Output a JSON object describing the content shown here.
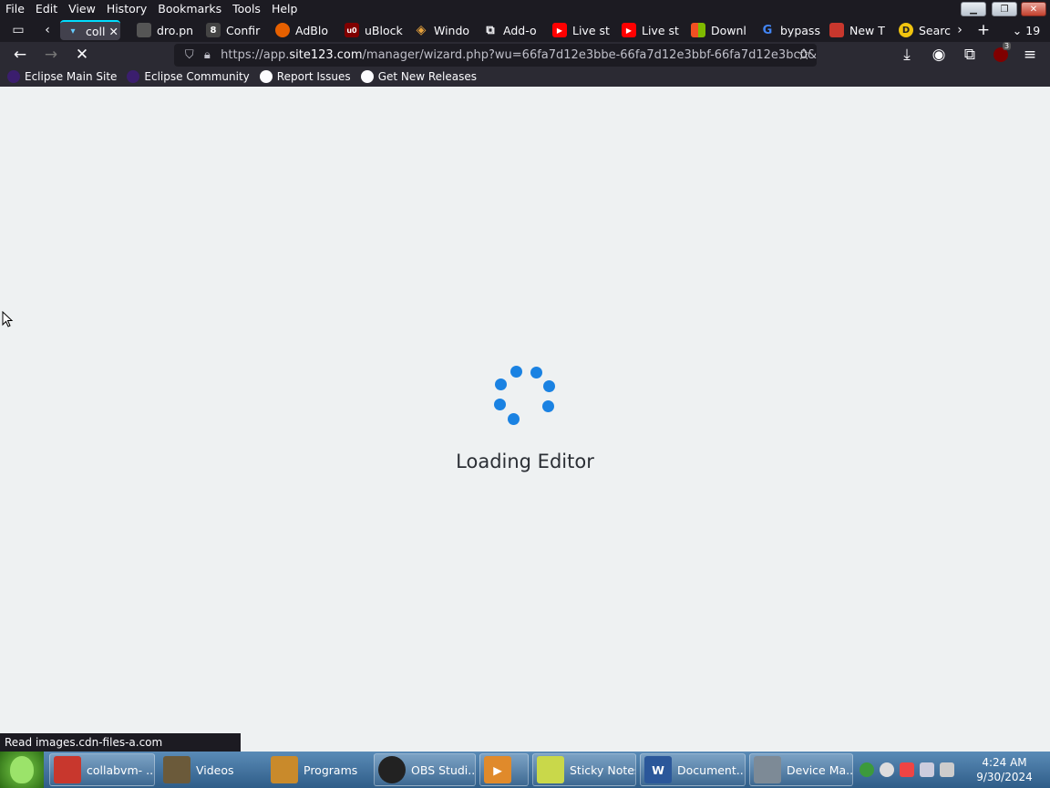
{
  "menubar": {
    "items": [
      "File",
      "Edit",
      "View",
      "History",
      "Bookmarks",
      "Tools",
      "Help"
    ]
  },
  "tabs": [
    {
      "label": "coll",
      "color": "#42414d",
      "icon": "firefox-tab-icon",
      "active": true
    },
    {
      "label": "dro.pn",
      "color": "#3a3a3a",
      "icon": "image-icon"
    },
    {
      "label": "Confir",
      "color": "#444",
      "icon": "number-8-icon"
    },
    {
      "label": "AdBlo",
      "color": "#e66000",
      "icon": "firefox-icon"
    },
    {
      "label": "uBlock",
      "color": "#800000",
      "icon": "ublock-icon"
    },
    {
      "label": "Windo",
      "color": "#e8a33d",
      "icon": "diamond-icon"
    },
    {
      "label": "Add-o",
      "color": "#fbfbfe",
      "icon": "puzzle-icon"
    },
    {
      "label": "Live st",
      "color": "#ff0000",
      "icon": "youtube-icon"
    },
    {
      "label": "Live st",
      "color": "#ff0000",
      "icon": "youtube-icon"
    },
    {
      "label": "Downl",
      "color": "#00a4ef",
      "icon": "windows-icon"
    },
    {
      "label": "bypass",
      "color": "#4285f4",
      "icon": "google-icon"
    },
    {
      "label": "New T",
      "color": "#c8372d",
      "icon": "gitlab-icon"
    },
    {
      "label": "Search",
      "color": "#f1c40f",
      "icon": "search-engine-icon"
    }
  ],
  "tab_count": "19",
  "url": {
    "prefix": "https://app.",
    "host": "site123.com",
    "path": "/manager/wizard.php?wu=66fa7d12e3bbe-66fa7d12e3bbf-66fa7d12e3bc0&"
  },
  "bookmarks": [
    {
      "label": "Eclipse Main Site",
      "color": "#3b1e6e"
    },
    {
      "label": "Eclipse Community",
      "color": "#3b1e6e"
    },
    {
      "label": "Report Issues",
      "color": "#fbfbfe"
    },
    {
      "label": "Get New Releases",
      "color": "#fbfbfe"
    }
  ],
  "content": {
    "loading_text": "Loading Editor",
    "spinner_color": "#1a82e2",
    "background": "#eef1f2"
  },
  "status_text": "Read images.cdn-files-a.com",
  "taskbar": {
    "items": [
      {
        "label": "collabvm- ...",
        "color": "#c8372d"
      },
      {
        "label": "Videos",
        "color": "#6b5a3a"
      },
      {
        "label": "Programs",
        "color": "#c98a2b"
      },
      {
        "label": "OBS Studi...",
        "color": "#222"
      },
      {
        "label": "",
        "color": "#e08a2b"
      },
      {
        "label": "Sticky Notes",
        "color": "#c9d84a"
      },
      {
        "label": "Document...",
        "color": "#2b579a"
      },
      {
        "label": "Device Ma...",
        "color": "#7d8a96"
      }
    ],
    "clock_time": "4:24 AM",
    "clock_date": "9/30/2024"
  },
  "extension_badge": "3"
}
